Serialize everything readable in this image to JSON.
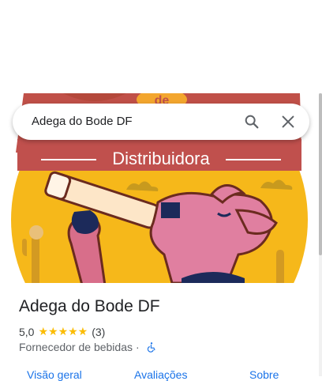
{
  "search": {
    "query": "Adega do Bode DF"
  },
  "hero": {
    "banner_text": "Distribuidora",
    "top_text_fragment": "de"
  },
  "place": {
    "title": "Adega do Bode DF",
    "rating": "5,0",
    "stars": "★★★★★",
    "review_count": "(3)",
    "category": "Fornecedor de bebidas",
    "separator": "·"
  },
  "tabs": [
    "Visão geral",
    "Avaliações",
    "Sobre"
  ],
  "icons": [
    "search-icon",
    "close-icon",
    "wheelchair-accessible-icon"
  ],
  "colors": {
    "accent": "#1a73e8",
    "star": "#fbbc04",
    "banner": "#c0504d",
    "sun": "#fbbf16",
    "goat": "#e07fa0"
  }
}
